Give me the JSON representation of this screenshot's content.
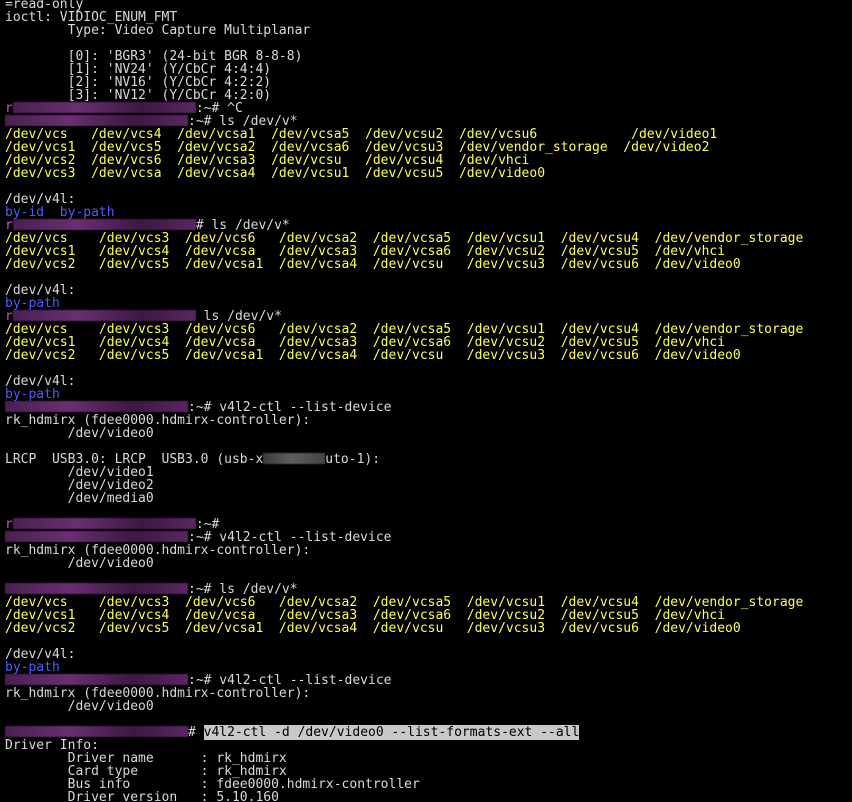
{
  "colors": {
    "background": "#000000",
    "text": "#d9d9d9",
    "device": "#ffff54",
    "directory": "#4d5cff",
    "prompt_mark": "#d050d8",
    "highlight_bg": "#c8c8c8",
    "highlight_fg": "#000000"
  },
  "lines": [
    {
      "kind": "text",
      "segs": [
        {
          "t": "=read-only"
        }
      ]
    },
    {
      "kind": "text",
      "segs": [
        {
          "t": "ioctl: VIDIOC_ENUM_FMT"
        }
      ]
    },
    {
      "kind": "text",
      "segs": [
        {
          "t": "        Type: Video Capture Multiplanar"
        }
      ]
    },
    {
      "kind": "blank"
    },
    {
      "kind": "text",
      "segs": [
        {
          "t": "        [0]: 'BGR3' (24-bit BGR 8-8-8)"
        }
      ]
    },
    {
      "kind": "text",
      "segs": [
        {
          "t": "        [1]: 'NV24' (Y/CbCr 4:4:4)"
        }
      ]
    },
    {
      "kind": "text",
      "segs": [
        {
          "t": "        [2]: 'NV16' (Y/CbCr 4:2:2)"
        }
      ]
    },
    {
      "kind": "text",
      "segs": [
        {
          "t": "        [3]: 'NV12' (Y/CbCr 4:2:0)"
        }
      ]
    },
    {
      "kind": "prompt",
      "segs": [
        {
          "t": "r",
          "c": "prompt_mark"
        },
        {
          "blur": "prompt"
        },
        {
          "t": ":~# ^C"
        }
      ]
    },
    {
      "kind": "prompt",
      "segs": [
        {
          "blur": "prompt"
        },
        {
          "t": ":~# ls /dev/v*"
        }
      ]
    },
    {
      "kind": "text",
      "segs": [
        {
          "t": "/dev/vcs   /dev/vcs4  /dev/vcsa1  /dev/vcsa5  /dev/vcsu2  /dev/vcsu6            /dev/video1",
          "c": "device"
        }
      ]
    },
    {
      "kind": "text",
      "segs": [
        {
          "t": "/dev/vcs1  /dev/vcs5  /dev/vcsa2  /dev/vcsa6  /dev/vcsu3  /dev/vendor_storage  /dev/video2",
          "c": "device"
        }
      ]
    },
    {
      "kind": "text",
      "segs": [
        {
          "t": "/dev/vcs2  /dev/vcs6  /dev/vcsa3  /dev/vcsu   /dev/vcsu4  /dev/vhci",
          "c": "device"
        }
      ]
    },
    {
      "kind": "text",
      "segs": [
        {
          "t": "/dev/vcs3  /dev/vcsa  /dev/vcsa4  /dev/vcsu1  /dev/vcsu5  /dev/video0",
          "c": "device"
        }
      ]
    },
    {
      "kind": "blank"
    },
    {
      "kind": "text",
      "segs": [
        {
          "t": "/dev/v4l:"
        }
      ]
    },
    {
      "kind": "text",
      "segs": [
        {
          "t": "by-id  by-path",
          "c": "directory"
        }
      ]
    },
    {
      "kind": "prompt",
      "segs": [
        {
          "t": "r",
          "c": "prompt_mark"
        },
        {
          "blur": "prompt"
        },
        {
          "t": "# ls /dev/v*"
        }
      ]
    },
    {
      "kind": "text",
      "segs": [
        {
          "t": "/dev/vcs    /dev/vcs3  /dev/vcs6   /dev/vcsa2  /dev/vcsa5  /dev/vcsu1  /dev/vcsu4  /dev/vendor_storage",
          "c": "device"
        }
      ]
    },
    {
      "kind": "text",
      "segs": [
        {
          "t": "/dev/vcs1   /dev/vcs4  /dev/vcsa   /dev/vcsa3  /dev/vcsa6  /dev/vcsu2  /dev/vcsu5  /dev/vhci",
          "c": "device"
        }
      ]
    },
    {
      "kind": "text",
      "segs": [
        {
          "t": "/dev/vcs2   /dev/vcs5  /dev/vcsa1  /dev/vcsa4  /dev/vcsu   /dev/vcsu3  /dev/vcsu6  /dev/video0",
          "c": "device"
        }
      ]
    },
    {
      "kind": "blank"
    },
    {
      "kind": "text",
      "segs": [
        {
          "t": "/dev/v4l:"
        }
      ]
    },
    {
      "kind": "text",
      "segs": [
        {
          "t": "by-path",
          "c": "directory"
        }
      ]
    },
    {
      "kind": "prompt",
      "segs": [
        {
          "t": "r",
          "c": "prompt_mark"
        },
        {
          "blur": "prompt"
        },
        {
          "t": " ls /dev/v*"
        }
      ]
    },
    {
      "kind": "text",
      "segs": [
        {
          "t": "/dev/vcs    /dev/vcs3  /dev/vcs6   /dev/vcsa2  /dev/vcsa5  /dev/vcsu1  /dev/vcsu4  /dev/vendor_storage",
          "c": "device"
        }
      ]
    },
    {
      "kind": "text",
      "segs": [
        {
          "t": "/dev/vcs1   /dev/vcs4  /dev/vcsa   /dev/vcsa3  /dev/vcsa6  /dev/vcsu2  /dev/vcsu5  /dev/vhci",
          "c": "device"
        }
      ]
    },
    {
      "kind": "text",
      "segs": [
        {
          "t": "/dev/vcs2   /dev/vcs5  /dev/vcsa1  /dev/vcsa4  /dev/vcsu   /dev/vcsu3  /dev/vcsu6  /dev/video0",
          "c": "device"
        }
      ]
    },
    {
      "kind": "blank"
    },
    {
      "kind": "text",
      "segs": [
        {
          "t": "/dev/v4l:"
        }
      ]
    },
    {
      "kind": "text",
      "segs": [
        {
          "t": "by-path",
          "c": "directory"
        }
      ]
    },
    {
      "kind": "prompt",
      "segs": [
        {
          "blur": "prompt"
        },
        {
          "t": ":~# v4l2-ctl --list-device"
        }
      ]
    },
    {
      "kind": "text",
      "segs": [
        {
          "t": "rk_hdmirx (fdee0000.hdmirx-controller):"
        }
      ]
    },
    {
      "kind": "text",
      "segs": [
        {
          "t": "        /dev/video0"
        }
      ]
    },
    {
      "kind": "blank"
    },
    {
      "kind": "text",
      "segs": [
        {
          "t": "LRCP  USB3.0: LRCP  USB3.0 (usb-x"
        },
        {
          "blur": "inline"
        },
        {
          "t": "uto-1):"
        }
      ]
    },
    {
      "kind": "text",
      "segs": [
        {
          "t": "        /dev/video1"
        }
      ]
    },
    {
      "kind": "text",
      "segs": [
        {
          "t": "        /dev/video2"
        }
      ]
    },
    {
      "kind": "text",
      "segs": [
        {
          "t": "        /dev/media0"
        }
      ]
    },
    {
      "kind": "blank"
    },
    {
      "kind": "prompt",
      "segs": [
        {
          "t": "r",
          "c": "prompt_mark"
        },
        {
          "blur": "prompt"
        },
        {
          "t": ":~#"
        }
      ]
    },
    {
      "kind": "prompt",
      "segs": [
        {
          "blur": "prompt"
        },
        {
          "t": ":~# v4l2-ctl --list-device"
        }
      ]
    },
    {
      "kind": "text",
      "segs": [
        {
          "t": "rk_hdmirx (fdee0000.hdmirx-controller):"
        }
      ]
    },
    {
      "kind": "text",
      "segs": [
        {
          "t": "        /dev/video0"
        }
      ]
    },
    {
      "kind": "blank"
    },
    {
      "kind": "prompt",
      "segs": [
        {
          "blur": "prompt"
        },
        {
          "t": ":~# ls /dev/v*"
        }
      ]
    },
    {
      "kind": "text",
      "segs": [
        {
          "t": "/dev/vcs    /dev/vcs3  /dev/vcs6   /dev/vcsa2  /dev/vcsa5  /dev/vcsu1  /dev/vcsu4  /dev/vendor_storage",
          "c": "device"
        }
      ]
    },
    {
      "kind": "text",
      "segs": [
        {
          "t": "/dev/vcs1   /dev/vcs4  /dev/vcsa   /dev/vcsa3  /dev/vcsa6  /dev/vcsu2  /dev/vcsu5  /dev/vhci",
          "c": "device"
        }
      ]
    },
    {
      "kind": "text",
      "segs": [
        {
          "t": "/dev/vcs2   /dev/vcs5  /dev/vcsa1  /dev/vcsa4  /dev/vcsu   /dev/vcsu3  /dev/vcsu6  /dev/video0",
          "c": "device"
        }
      ]
    },
    {
      "kind": "blank"
    },
    {
      "kind": "text",
      "segs": [
        {
          "t": "/dev/v4l:"
        }
      ]
    },
    {
      "kind": "text",
      "segs": [
        {
          "t": "by-path",
          "c": "directory"
        }
      ]
    },
    {
      "kind": "prompt",
      "segs": [
        {
          "blur": "prompt"
        },
        {
          "t": ":~# v4l2-ctl --list-device"
        }
      ]
    },
    {
      "kind": "text",
      "segs": [
        {
          "t": "rk_hdmirx (fdee0000.hdmirx-controller):"
        }
      ]
    },
    {
      "kind": "text",
      "segs": [
        {
          "t": "        /dev/video0"
        }
      ]
    },
    {
      "kind": "blank"
    },
    {
      "kind": "prompt",
      "segs": [
        {
          "blur": "prompt"
        },
        {
          "t": "# "
        },
        {
          "t": "v4l2-ctl -d /dev/video0 --list-formats-ext --all",
          "hl": true
        }
      ]
    },
    {
      "kind": "text",
      "segs": [
        {
          "t": "Driver Info:"
        }
      ]
    },
    {
      "kind": "text",
      "segs": [
        {
          "t": "        Driver name      : rk_hdmirx"
        }
      ]
    },
    {
      "kind": "text",
      "segs": [
        {
          "t": "        Card type        : rk_hdmirx"
        }
      ]
    },
    {
      "kind": "text",
      "segs": [
        {
          "t": "        Bus info         : fdee0000.hdmirx-controller"
        }
      ]
    },
    {
      "kind": "text",
      "segs": [
        {
          "t": "        Driver version   : 5.10.160"
        }
      ]
    }
  ]
}
